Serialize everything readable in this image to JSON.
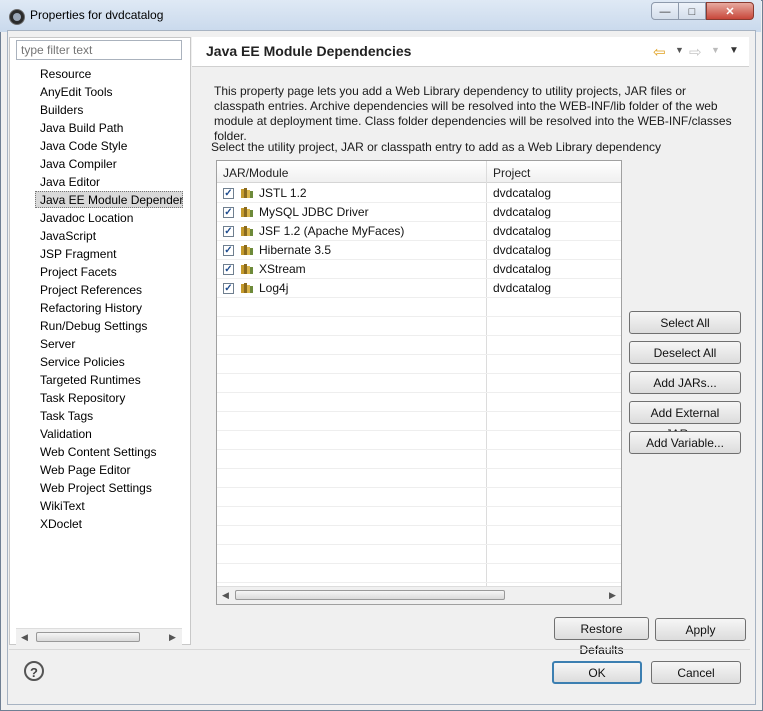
{
  "window": {
    "title": "Properties for dvdcatalog"
  },
  "filter": {
    "placeholder": "type filter text"
  },
  "nav": {
    "items": [
      "Resource",
      "AnyEdit Tools",
      "Builders",
      "Java Build Path",
      "Java Code Style",
      "Java Compiler",
      "Java Editor",
      "Java EE Module Dependencies",
      "Javadoc Location",
      "JavaScript",
      "JSP Fragment",
      "Project Facets",
      "Project References",
      "Refactoring History",
      "Run/Debug Settings",
      "Server",
      "Service Policies",
      "Targeted Runtimes",
      "Task Repository",
      "Task Tags",
      "Validation",
      "Web Content Settings",
      "Web Page Editor",
      "Web Project Settings",
      "WikiText",
      "XDoclet"
    ],
    "selected_index": 7
  },
  "page": {
    "title": "Java EE Module Dependencies",
    "description": "This property page lets you add a Web Library dependency to utility projects, JAR files or classpath entries. Archive dependencies will be resolved into the WEB-INF/lib folder of the web module at deployment time. Class folder dependencies will be resolved into the WEB-INF/classes folder.",
    "select_label": "Select the utility project, JAR or classpath entry to add as a Web Library dependency"
  },
  "table": {
    "columns": [
      "JAR/Module",
      "Project"
    ],
    "rows": [
      {
        "name": "JSTL 1.2",
        "project": "dvdcatalog",
        "checked": true
      },
      {
        "name": "MySQL JDBC Driver",
        "project": "dvdcatalog",
        "checked": true
      },
      {
        "name": "JSF 1.2 (Apache MyFaces)",
        "project": "dvdcatalog",
        "checked": true
      },
      {
        "name": "Hibernate 3.5",
        "project": "dvdcatalog",
        "checked": true
      },
      {
        "name": "XStream",
        "project": "dvdcatalog",
        "checked": true
      },
      {
        "name": "Log4j",
        "project": "dvdcatalog",
        "checked": true
      }
    ]
  },
  "buttons": {
    "select_all": "Select All",
    "deselect_all": "Deselect All",
    "add_jars": "Add JARs...",
    "add_external_jars": "Add External JARs...",
    "add_variable": "Add Variable...",
    "restore_defaults": "Restore Defaults",
    "apply": "Apply",
    "ok": "OK",
    "cancel": "Cancel"
  },
  "icons": {
    "help": "help-icon",
    "back": "back-arrow-icon",
    "forward": "forward-arrow-icon",
    "view_menu": "view-menu-icon"
  },
  "colors": {
    "titlebar": "#c9d9ec",
    "ok_border": "#3c7fb1",
    "nav_back_arrow": "#e0a120"
  }
}
